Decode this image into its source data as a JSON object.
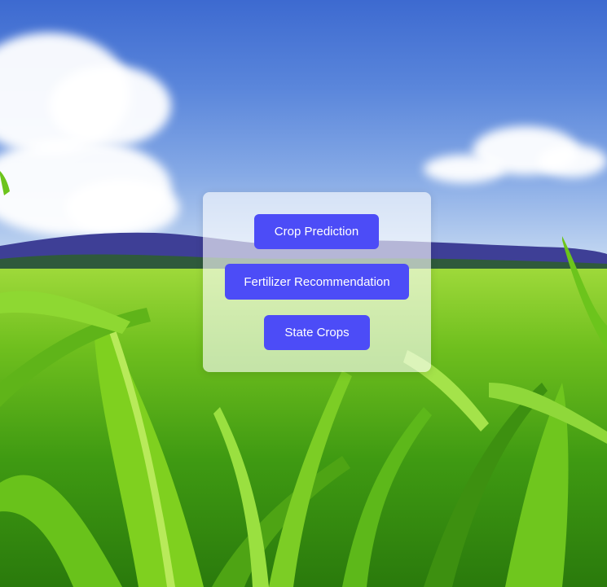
{
  "menu": {
    "crop_prediction_label": "Crop Prediction",
    "fertilizer_recommendation_label": "Fertilizer Recommendation",
    "state_crops_label": "State Crops"
  },
  "colors": {
    "button": "#4c4cf7",
    "button_text": "#ffffff",
    "panel": "rgba(255,255,255,0.62)"
  }
}
